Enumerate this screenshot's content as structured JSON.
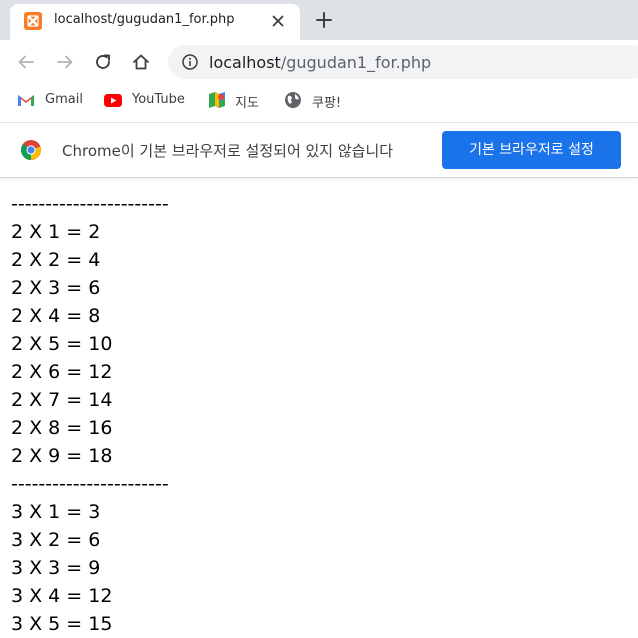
{
  "tab": {
    "title": "localhost/gugudan1_for.php"
  },
  "address_bar": {
    "host": "localhost",
    "path": "/gugudan1_for.php"
  },
  "bookmarks": [
    {
      "label": "Gmail",
      "icon": "gmail-icon"
    },
    {
      "label": "YouTube",
      "icon": "youtube-icon"
    },
    {
      "label": "지도",
      "icon": "maps-icon"
    },
    {
      "label": "쿠팡!",
      "icon": "globe-icon"
    }
  ],
  "infobar": {
    "message": "Chrome이 기본 브라우저로 설정되어 있지 않습니다",
    "button_label": "기본 브라우저로 설정"
  },
  "page": {
    "lines": [
      "-----------------------",
      "2 X 1 = 2",
      "2 X 2 = 4",
      "2 X 3 = 6",
      "2 X 4 = 8",
      "2 X 5 = 10",
      "2 X 6 = 12",
      "2 X 7 = 14",
      "2 X 8 = 16",
      "2 X 9 = 18",
      "-----------------------",
      "3 X 1 = 3",
      "3 X 2 = 6",
      "3 X 3 = 9",
      "3 X 4 = 12",
      "3 X 5 = 15"
    ]
  },
  "colors": {
    "tabstrip": "#dee1e6",
    "accent_button": "#1a73e8",
    "xampp_orange": "#fb7a24"
  }
}
